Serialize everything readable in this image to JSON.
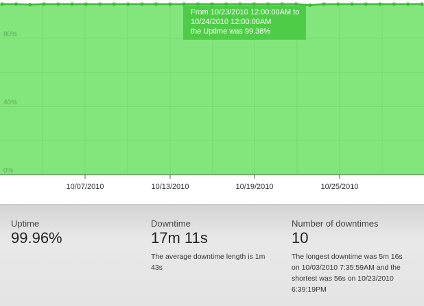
{
  "chart_data": {
    "type": "area",
    "yticks": [
      "0%",
      "40%",
      "80%"
    ],
    "ylim": [
      0,
      100
    ],
    "xticks": [
      "10/07/2010",
      "10/13/2010",
      "10/19/2010",
      "10/25/2010"
    ],
    "series": [
      {
        "values": [
          100,
          100,
          99.7,
          100,
          100,
          100,
          100,
          100,
          100,
          100,
          100,
          100,
          100,
          100,
          100,
          100,
          100,
          100,
          100,
          100,
          100,
          100,
          99.38,
          100,
          100,
          100,
          100,
          100,
          100,
          100,
          100
        ]
      }
    ],
    "tooltip": {
      "line1": "From 10/23/2010 12:00:00AM to",
      "line2": "10/24/2010 12:00:00AM",
      "line3": "the Uptime was 99.38%"
    },
    "colors": {
      "area": "#83e67c",
      "line": "#3dbb35",
      "point": "#3dbb35",
      "grid": "#6fd468",
      "tooltip": "#4fcc47"
    }
  },
  "stats": {
    "uptime": {
      "label": "Uptime",
      "value": "99.96%"
    },
    "downtime": {
      "label": "Downtime",
      "value": "17m 11s",
      "note": [
        "The average downtime length is 1m",
        "43s"
      ]
    },
    "downtimes": {
      "label": "Number of downtimes",
      "value": "10",
      "note": [
        "The longest downtime was 5m 16s",
        "on 10/03/2010 7:35:59AM and the",
        "shortest was 56s on 10/23/2010",
        "6:39:19PM"
      ]
    }
  }
}
